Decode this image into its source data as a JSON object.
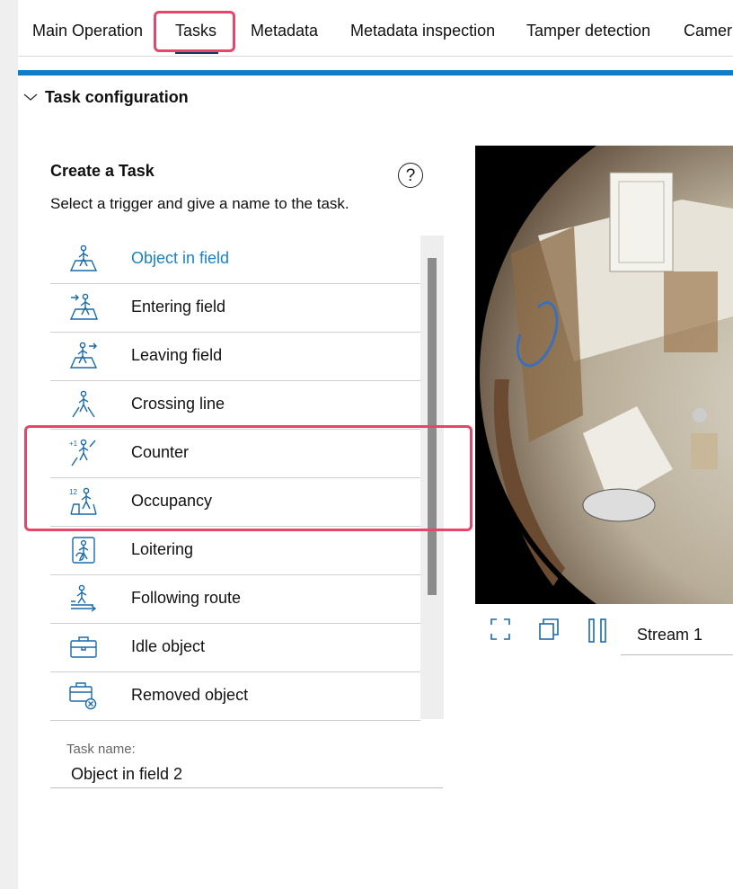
{
  "tabs": [
    "Main Operation",
    "Tasks",
    "Metadata",
    "Metadata inspection",
    "Tamper detection",
    "Camer"
  ],
  "active_tab": "Tasks",
  "section": {
    "title": "Task configuration"
  },
  "create": {
    "title": "Create a Task",
    "subtitle": "Select a trigger and give a name to the task.",
    "help_symbol": "?"
  },
  "triggers": [
    {
      "label": "Object in field",
      "icon": "object-in-field-icon",
      "selected": true
    },
    {
      "label": "Entering field",
      "icon": "entering-field-icon"
    },
    {
      "label": "Leaving field",
      "icon": "leaving-field-icon"
    },
    {
      "label": "Crossing line",
      "icon": "crossing-line-icon"
    },
    {
      "label": "Counter",
      "icon": "counter-icon"
    },
    {
      "label": "Occupancy",
      "icon": "occupancy-icon"
    },
    {
      "label": "Loitering",
      "icon": "loitering-icon"
    },
    {
      "label": "Following route",
      "icon": "following-route-icon"
    },
    {
      "label": "Idle object",
      "icon": "idle-object-icon"
    },
    {
      "label": "Removed object",
      "icon": "removed-object-icon"
    }
  ],
  "task_name": {
    "label": "Task name:",
    "value": "Object in field 2"
  },
  "video": {
    "stream": "Stream 1",
    "controls": [
      "fullscreen-icon",
      "popout-window-icon",
      "pause-icon"
    ]
  },
  "colors": {
    "accent": "#0e7fc6",
    "selected_text": "#1a82c4",
    "highlight": "#e8456a",
    "tab_underline": "#0a3d62"
  }
}
